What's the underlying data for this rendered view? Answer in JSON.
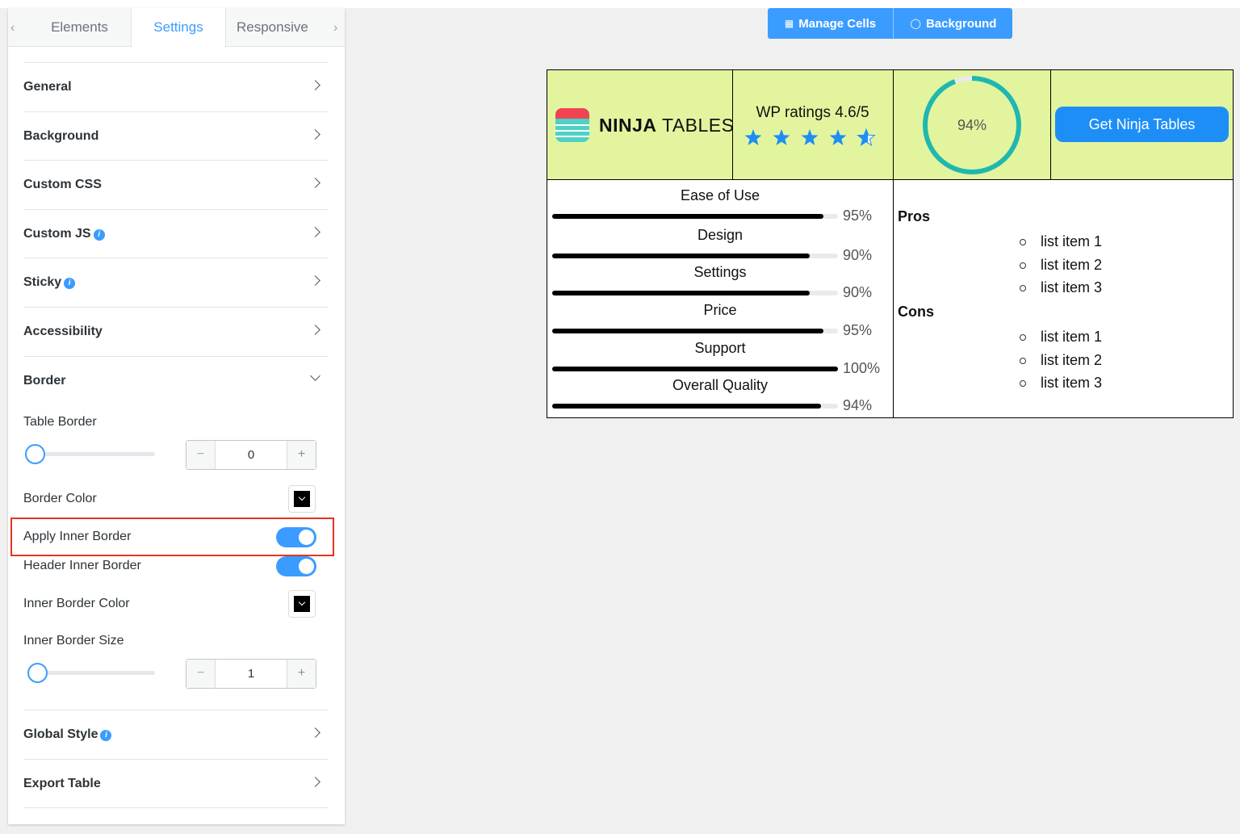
{
  "sidebar": {
    "tabs": [
      "Elements",
      "Settings",
      "Responsive"
    ],
    "active_tab": "Settings",
    "sections": [
      "General",
      "Background",
      "Custom CSS",
      "Custom JS",
      "Sticky",
      "Accessibility",
      "Border",
      "Global Style",
      "Export Table"
    ],
    "border": {
      "table_border_label": "Table Border",
      "table_border_value": "0",
      "border_color_label": "Border Color",
      "border_color": "#000000",
      "apply_inner_border_label": "Apply Inner Border",
      "apply_inner_border_on": true,
      "header_inner_border_label": "Header Inner Border",
      "header_inner_border_on": true,
      "inner_border_color_label": "Inner Border Color",
      "inner_border_color": "#000000",
      "inner_border_size_label": "Inner Border Size",
      "inner_border_size_value": "1"
    }
  },
  "toolbar": {
    "manage_cells": "Manage Cells",
    "background": "Background",
    "color": "#3b9cff"
  },
  "preview": {
    "header_bg": "#e2f59e",
    "logo_bold": "NINJA",
    "logo_light": " TABLES",
    "wp_rating_text": "WP ratings 4.6/5",
    "rating": 4.6,
    "rating_max": 5,
    "progress_percent": 94,
    "progress_label": "94%",
    "progress_color": "#1fb8ae",
    "cta_label": "Get Ninja Tables",
    "cta_color": "#1e8ef7",
    "metrics": [
      {
        "name": "Ease of Use",
        "value": 95,
        "label": "95%"
      },
      {
        "name": "Design",
        "value": 90,
        "label": "90%"
      },
      {
        "name": "Settings",
        "value": 90,
        "label": "90%"
      },
      {
        "name": "Price",
        "value": 95,
        "label": "95%"
      },
      {
        "name": "Support",
        "value": 100,
        "label": "100%"
      },
      {
        "name": "Overall Quality",
        "value": 94,
        "label": "94%"
      }
    ],
    "pros_title": "Pros",
    "pros": [
      "list item 1",
      "list item 2",
      "list item 3"
    ],
    "cons_title": "Cons",
    "cons": [
      "list item 1",
      "list item 2",
      "list item 3"
    ]
  }
}
